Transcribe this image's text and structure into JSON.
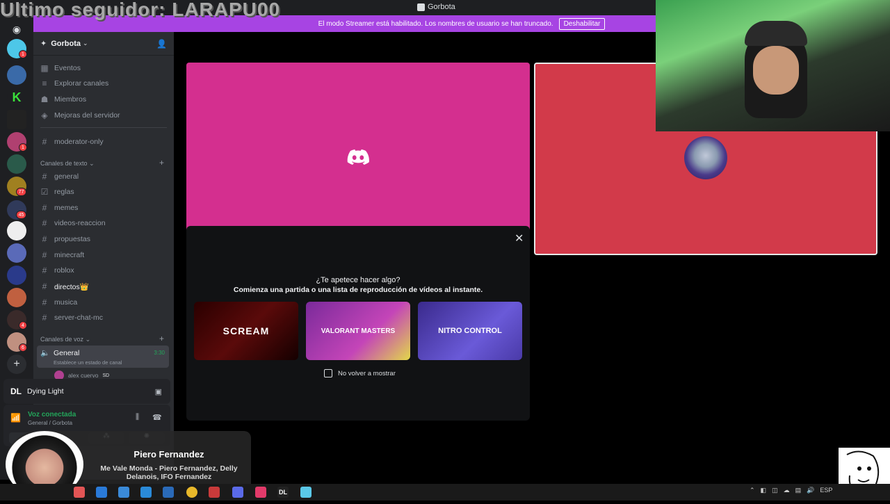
{
  "overlay": {
    "title": "Ultimo seguidor: LARAPU00"
  },
  "window": {
    "title": "Gorbota"
  },
  "banner": {
    "text": "El modo Streamer está habilitado. Los nombres de usuario se han truncado.",
    "button": "Deshabilitar"
  },
  "servers": {
    "badges": [
      "1",
      "1",
      "77",
      "45",
      "4",
      "6"
    ]
  },
  "sidebar": {
    "server_name": "Gorbota",
    "nav": [
      {
        "label": "Eventos",
        "icon": "calendar-icon"
      },
      {
        "label": "Explorar canales",
        "icon": "list-icon"
      },
      {
        "label": "Miembros",
        "icon": "members-icon"
      },
      {
        "label": "Mejoras del servidor",
        "icon": "boost-icon"
      }
    ],
    "pinned_channel": "moderator-only",
    "text_section": "Canales de texto",
    "text_channels": [
      "general",
      "reglas",
      "memes",
      "videos-reaccion",
      "propuestas",
      "minecraft",
      "roblox",
      "directos👑",
      "musica",
      "server-chat-mc"
    ],
    "voice_section": "Canales de voz",
    "voice_channel": {
      "name": "General",
      "time": "3:30",
      "status": "Establece un estado de canal",
      "user": "alex cuervo",
      "user_tag": "SD"
    }
  },
  "activity": {
    "game": "Dying Light",
    "game_logo": "DL"
  },
  "voice_panel": {
    "status": "Voz conectada",
    "location": "General / Gorbota"
  },
  "popup": {
    "title": "¿Te apetece hacer algo?",
    "subtitle": "Comienza una partida o una lista de reproducción de vídeos al instante.",
    "cards": [
      "SCREAM",
      "VALORANT MASTERS",
      "NITRO CONTROL"
    ],
    "checkbox": "No volver a mostrar"
  },
  "now_playing": {
    "artist": "Piero Fernandez",
    "song": "Me Vale Monda - Piero Fernandez, Delly Delanois, IFO Fernandez"
  },
  "taskbar": {
    "lang": "ESP"
  },
  "colors": {
    "banner": "#a744e3",
    "tile_pink": "#d42f8f",
    "tile_red": "#d23a4a",
    "voice_green": "#23a55a"
  }
}
